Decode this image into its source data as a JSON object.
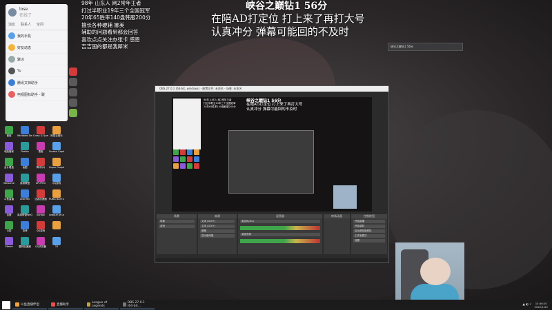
{
  "stream_title": "峡谷之巅钻1 56分",
  "stream_sub": [
    "在陪AD打定位 打上来了再打大号",
    "认真冲分 弹幕可能回的不及时"
  ],
  "overlay_lines": [
    "98年 山东人 网2常年王者",
    "打过半职业19年三个全国冠军",
    "20年65胜率140盘韩服200分",
    "擅长各种硬辅 娜美",
    "辅助的问题看到都会回答",
    "喜欢点点关注办张卡 感恩",
    "吉吉国的都是我犀米"
  ],
  "chat": {
    "user": "lose",
    "status": "在线了",
    "tabs": [
      "消息",
      "联系人",
      "空间"
    ],
    "rows": [
      "我的手机",
      "好友动态",
      "聚冰",
      "Yu",
      "腾讯文档助手",
      "电视图标助手 - 联"
    ]
  },
  "small_window_title": "峡谷之巅钻1 56分",
  "obs": {
    "title": "OBS 27.0.1 (64-bit, windows) - 配置文件: 未命名 - 场景: 未命名",
    "panels": [
      "场景",
      "来源",
      "混音器",
      "转场动画",
      "控制按钮"
    ],
    "scenes": [
      "场景",
      "游戏"
    ],
    "sources": [
      "文本 (GDI+)",
      "文本 (GDI+)",
      "图像",
      "显示器采集"
    ],
    "mixer": [
      "麦克风/Aux",
      "桌面音频",
      "麦克风/Aux 2"
    ],
    "controls": [
      "开始直播",
      "开始录制",
      "启动虚拟摄像机",
      "工作室模式",
      "设置",
      "退出"
    ]
  },
  "desktop_icons": [
    "微信",
    "Windows Defender",
    "Cross & Quest",
    "网易云音乐",
    "电脑管家",
    "Firefox",
    "看客",
    "Screen Capture",
    "会计看盘",
    "画图",
    "腾讯QQ",
    "Super People CBT",
    "WeGame",
    "英雄联盟",
    "UPUPOO",
    "QQ游戏",
    "斗鱼直播",
    "LeanTen",
    "迅游加速器",
    "PUBG BATTLEGROUNDS",
    "百度",
    "英雄联盟WeGame",
    "Sangui",
    "League of Legends",
    "火影",
    "游戏",
    "QQ游戏",
    "",
    "Steam",
    "雷神加速器",
    "QQ浏览器",
    "G1"
  ],
  "side_icons": [
    "网易云音乐",
    "Out Windows",
    "Out Win",
    "Out Wind",
    "ShadowPlay"
  ],
  "taskbar": {
    "items": [
      "斗鱼直播伴侣",
      "直播助手",
      "League of Legends",
      "OBS 27.0.1 (64-bit..."
    ],
    "time": "15:46:20",
    "date": "2022/1/22"
  },
  "colors": {
    "desktop": "#2a2628",
    "taskbar": "#1b1b1b",
    "obs_bg": "#2b2b2b",
    "accent": "#6aa0d8"
  }
}
